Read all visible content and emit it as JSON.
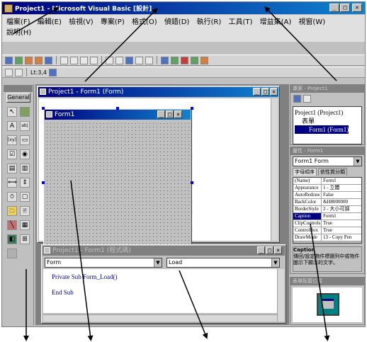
{
  "window": {
    "title": "Project1 - Microsoft Visual Basic [設計]",
    "controls": [
      "_",
      "□",
      "×"
    ]
  },
  "menu": [
    "檔案(F)",
    "編輯(E)",
    "檢視(V)",
    "專案(P)",
    "格式(O)",
    "偵錯(D)",
    "執行(R)",
    "工具(T)",
    "增益集(A)",
    "視窗(W)",
    "說明(H)"
  ],
  "toolbar": {
    "position": "Lt:3,4"
  },
  "toolbox": {
    "title": "General",
    "pointer_label": "↖",
    "tools": [
      "A",
      "ab|",
      "[xy]",
      "▭",
      "☑",
      "◉",
      "▤",
      "▥",
      "⟺",
      "⇕",
      "⏱",
      "▢",
      "🗀",
      "🖹",
      "╲",
      "▦",
      "◧",
      "⊞"
    ]
  },
  "form_window": {
    "title": "Project1 - Form1 (Form)",
    "form_caption": "Form1"
  },
  "code_window": {
    "title": "Project1 - Form1 (程式碼)",
    "object_combo": "Form",
    "proc_combo": "Load",
    "lines": [
      "Private Sub Form_Load()",
      "",
      "End Sub"
    ]
  },
  "project_explorer": {
    "title": "專案 - Project1",
    "items": [
      "Project1 (Project1)",
      "表單",
      "Form1 (Form1)"
    ]
  },
  "properties": {
    "title": "屬性 - Form1",
    "object": "Form1 Form",
    "tabs": [
      "字母順序",
      "依性質分類"
    ],
    "rows": [
      {
        "k": "(Name)",
        "v": "Form1"
      },
      {
        "k": "Appearance",
        "v": "1 - 立體"
      },
      {
        "k": "AutoRedraw",
        "v": "False"
      },
      {
        "k": "BackColor",
        "v": "&H8000000"
      },
      {
        "k": "BorderStyle",
        "v": "2 - 大小可調"
      },
      {
        "k": "Caption",
        "v": "Form1"
      },
      {
        "k": "ClipControls",
        "v": "True"
      },
      {
        "k": "ControlBox",
        "v": "True"
      },
      {
        "k": "DrawMode",
        "v": "13 - Copy Pen"
      }
    ],
    "desc_title": "Caption",
    "desc_text": "傳回/設定物件標題列中或物件圖示下顯示的文字。"
  },
  "layout_panel": {
    "title": "表單配置位置"
  },
  "colors": {
    "accent": "#000080",
    "face": "#c0c0c0"
  }
}
